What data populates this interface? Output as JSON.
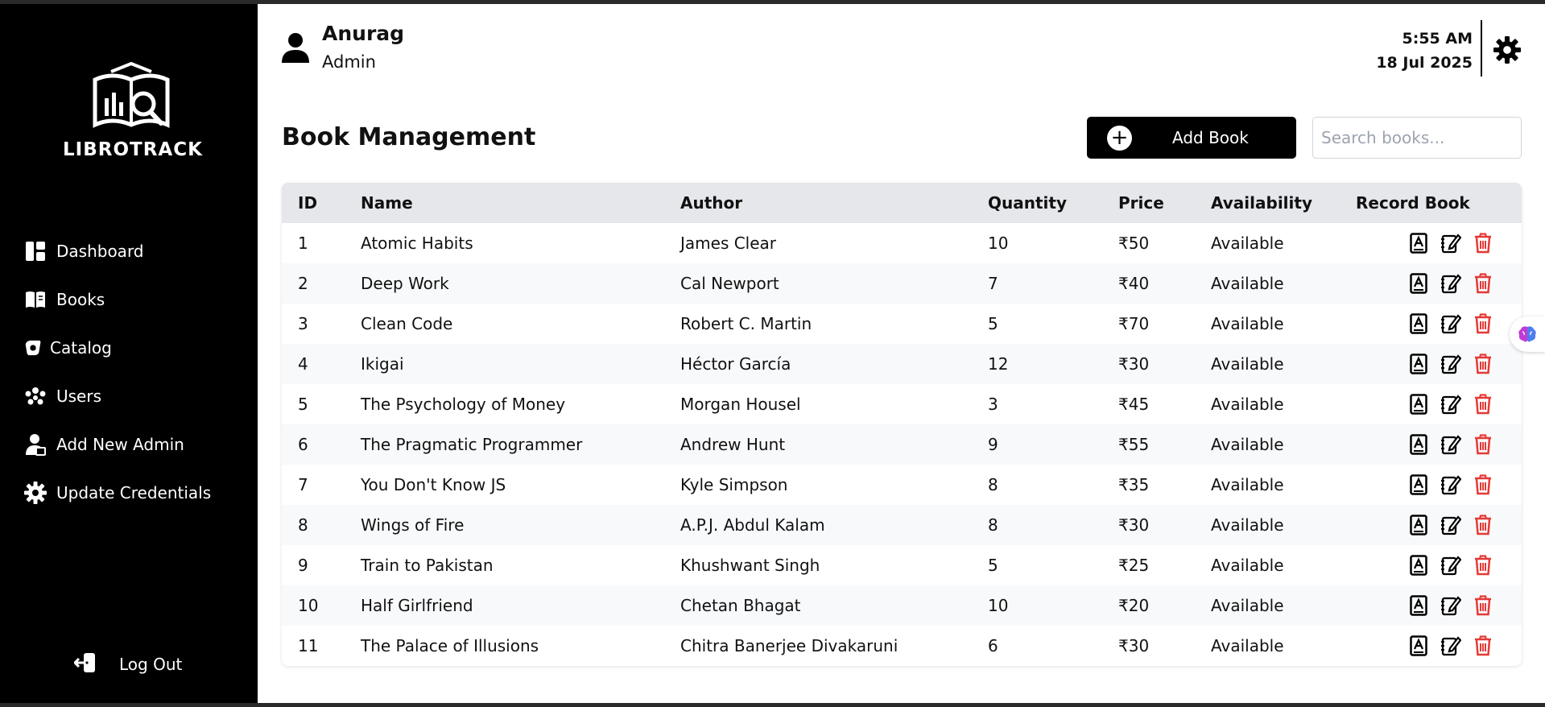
{
  "app": {
    "logo_text": "LIBROTRACK"
  },
  "sidebar": {
    "items": [
      {
        "label": "Dashboard",
        "icon": "dashboard-icon"
      },
      {
        "label": "Books",
        "icon": "book-icon"
      },
      {
        "label": "Catalog",
        "icon": "catalog-icon"
      },
      {
        "label": "Users",
        "icon": "users-icon"
      },
      {
        "label": "Add New Admin",
        "icon": "add-admin-icon"
      },
      {
        "label": "Update Credentials",
        "icon": "gear-icon"
      }
    ],
    "logout_label": "Log Out"
  },
  "header": {
    "user_name": "Anurag",
    "user_role": "Admin",
    "time": "5:55 AM",
    "date": "18 Jul 2025"
  },
  "page": {
    "title": "Book Management",
    "add_button_label": "Add Book",
    "search_placeholder": "Search books..."
  },
  "table": {
    "columns": [
      "ID",
      "Name",
      "Author",
      "Quantity",
      "Price",
      "Availability",
      "Record Book"
    ],
    "rows": [
      {
        "id": "1",
        "name": "Atomic Habits",
        "author": "James Clear",
        "quantity": "10",
        "price": "₹50",
        "availability": "Available"
      },
      {
        "id": "2",
        "name": "Deep Work",
        "author": "Cal Newport",
        "quantity": "7",
        "price": "₹40",
        "availability": "Available"
      },
      {
        "id": "3",
        "name": "Clean Code",
        "author": "Robert C. Martin",
        "quantity": "5",
        "price": "₹70",
        "availability": "Available"
      },
      {
        "id": "4",
        "name": "Ikigai",
        "author": "Héctor García",
        "quantity": "12",
        "price": "₹30",
        "availability": "Available"
      },
      {
        "id": "5",
        "name": "The Psychology of Money",
        "author": "Morgan Housel",
        "quantity": "3",
        "price": "₹45",
        "availability": "Available"
      },
      {
        "id": "6",
        "name": "The Pragmatic Programmer",
        "author": "Andrew Hunt",
        "quantity": "9",
        "price": "₹55",
        "availability": "Available"
      },
      {
        "id": "7",
        "name": "You Don't Know JS",
        "author": "Kyle Simpson",
        "quantity": "8",
        "price": "₹35",
        "availability": "Available"
      },
      {
        "id": "8",
        "name": "Wings of Fire",
        "author": "A.P.J. Abdul Kalam",
        "quantity": "8",
        "price": "₹30",
        "availability": "Available"
      },
      {
        "id": "9",
        "name": "Train to Pakistan",
        "author": "Khushwant Singh",
        "quantity": "5",
        "price": "₹25",
        "availability": "Available"
      },
      {
        "id": "10",
        "name": "Half Girlfriend",
        "author": "Chetan Bhagat",
        "quantity": "10",
        "price": "₹20",
        "availability": "Available"
      },
      {
        "id": "11",
        "name": "The Palace of Illusions",
        "author": "Chitra Banerjee Divakaruni",
        "quantity": "6",
        "price": "₹30",
        "availability": "Available"
      }
    ],
    "action_icons": [
      "record-book-icon",
      "edit-icon",
      "delete-icon"
    ]
  },
  "colors": {
    "sidebar_bg": "#000000",
    "primary_button": "#000000",
    "delete_icon": "#e53935",
    "table_header_bg": "#e5e7eb"
  }
}
